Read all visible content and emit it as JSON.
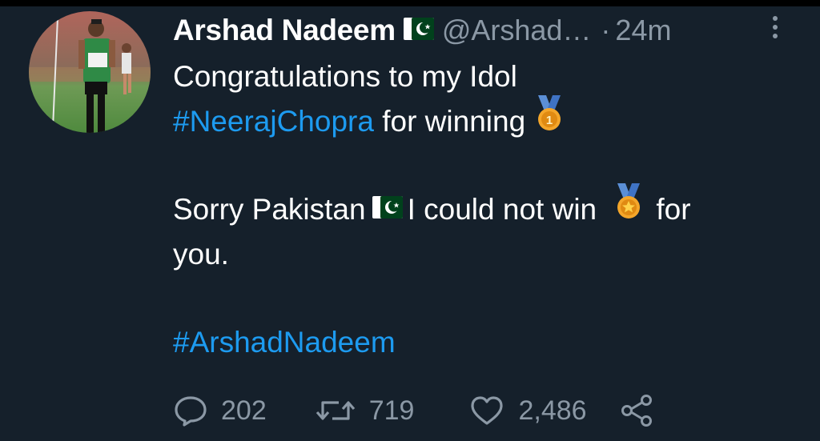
{
  "tweet": {
    "author_name": "Arshad Nadeem",
    "handle": "@Arshad…",
    "separator": "·",
    "time": "24m",
    "lines": [
      "Congratulations to my Idol",
      "for winning",
      "Sorry Pakistan",
      "I could not win",
      "for",
      "you."
    ],
    "hashtags": [
      "#NeerajChopra",
      "#ArshadNadeem"
    ],
    "medal_gold_digit": "1"
  },
  "actions": {
    "reply_count": "202",
    "retweet_count": "719",
    "like_count": "2,486"
  },
  "icons": {
    "more": "more-vertical-icon",
    "reply": "comment-bubble-icon",
    "retweet": "retweet-icon",
    "like": "heart-icon",
    "share": "share-icon",
    "flag": "pakistan-flag-icon",
    "medal_first": "first-place-medal-icon",
    "medal": "medal-icon"
  },
  "colors": {
    "background": "#15202b",
    "text": "#ffffff",
    "muted": "#8b98a5",
    "link": "#1d9bf0",
    "flag_green": "#01411c",
    "medal_gold": "#f4a62a",
    "ribbon_blue": "#5b8fd6"
  }
}
